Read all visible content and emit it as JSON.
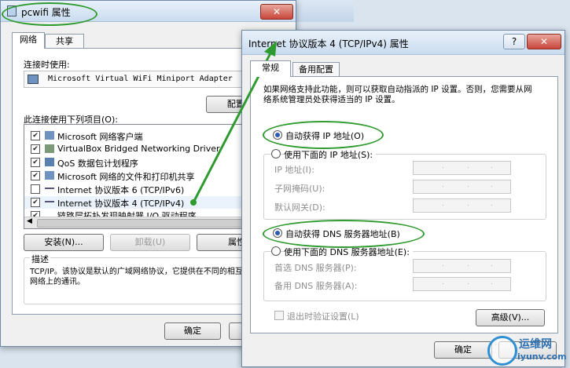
{
  "bg_window": {
    "title": "pcwifi 属性"
  },
  "left": {
    "title": "pcwifi 属性",
    "tabs": [
      "网络",
      "共享"
    ],
    "connect_label": "连接时使用:",
    "adapter": "Microsoft Virtual WiFi Miniport Adapter",
    "configure_button": "配置(C)",
    "items_label": "此连接使用下列项目(O):",
    "items": [
      {
        "label": "Microsoft 网络客户端",
        "checked": true
      },
      {
        "label": "VirtualBox Bridged Networking Driver",
        "checked": true
      },
      {
        "label": "QoS 数据包计划程序",
        "checked": true
      },
      {
        "label": "Microsoft 网络的文件和打印机共享",
        "checked": true
      },
      {
        "label": "Internet 协议版本 6 (TCP/IPv6)",
        "checked": false
      },
      {
        "label": "Internet 协议版本 4 (TCP/IPv4)",
        "checked": true
      },
      {
        "label": "链路层拓扑发现映射器 I/O 驱动程序",
        "checked": true
      }
    ],
    "install_button": "安装(N)...",
    "uninstall_button": "卸载(U)",
    "properties_button": "属性",
    "desc_title": "描述",
    "desc_text": "TCP/IP。该协议是默认的广域网络协议，它提供在不同的相互连接的网络上的通讯。",
    "ok_button": "确定"
  },
  "right": {
    "title": "Internet 协议版本 4 (TCP/IPv4) 属性",
    "help": "?",
    "close": "✕",
    "tabs": [
      "常规",
      "备用配置"
    ],
    "intro": "如果网络支持此功能，则可以获取自动指派的 IP 设置。否则，您需要从网络系统管理员处获得适当的 IP 设置。",
    "auto_ip": "自动获得 IP 地址(O)",
    "manual_ip": "使用下面的 IP 地址(S):",
    "ip_label": "IP 地址(I):",
    "mask_label": "子网掩码(U):",
    "gateway_label": "默认网关(D):",
    "auto_dns": "自动获得 DNS 服务器地址(B)",
    "manual_dns": "使用下面的 DNS 服务器地址(E):",
    "dns1_label": "首选 DNS 服务器(P):",
    "dns2_label": "备用 DNS 服务器(A):",
    "validate_label": "退出时验证设置(L)",
    "advanced_button": "高级(V)...",
    "ok_button": "确定"
  },
  "watermark": {
    "cn": "运维网",
    "en": "iyunv.com"
  },
  "colors": {
    "annotation": "#2f9a2f",
    "title_gradient_top": "#e9f1fa",
    "title_gradient_bottom": "#c9dcef"
  }
}
